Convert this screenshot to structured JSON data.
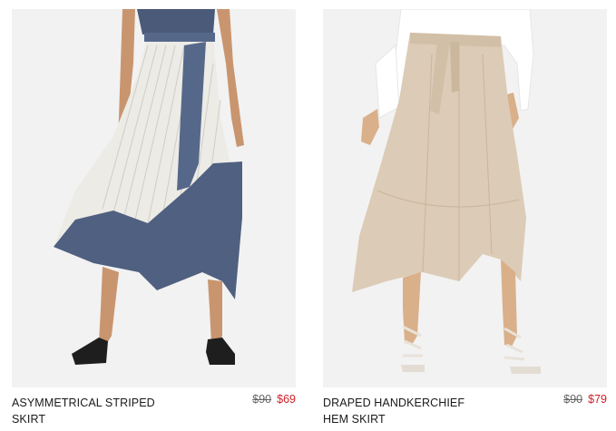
{
  "products": [
    {
      "name_line1": "ASYMMETRICAL STRIPED",
      "name_line2": "SKIRT",
      "price_original": "$90",
      "price_sale": "$69"
    },
    {
      "name_line1": "DRAPED HANDKERCHIEF",
      "name_line2": "HEM SKIRT",
      "price_original": "$90",
      "price_sale": "$79"
    }
  ],
  "colors": {
    "sale_price": "#d0202a",
    "original_price": "#666666",
    "photo_background": "#f2f2f2"
  }
}
